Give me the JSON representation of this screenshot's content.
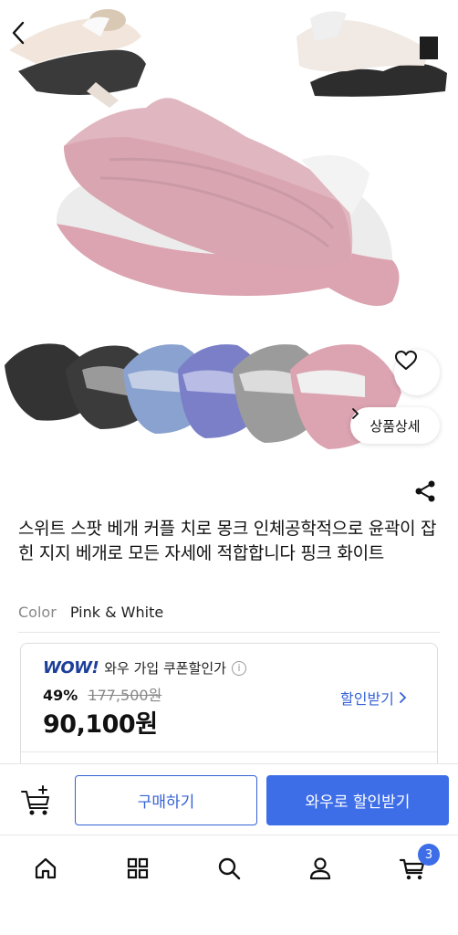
{
  "product": {
    "title": "스위트 스팟 베개 커플 치로 몽크 인체공학적으로 윤곽이 잡힌 지지 베개로 모든 자세에 적합합니다 핑크 화이트",
    "color_label": "Color",
    "color_value": "Pink & White",
    "detail_button": "상품상세",
    "image_alt": "pillow-product-image"
  },
  "price": {
    "wow_logo": "WOW!",
    "wow_caption": "와우 가입 쿠폰할인가",
    "discount_pct": "49%",
    "original_price": "177,500원",
    "final_price": "90,100원",
    "coupon_link": "할인받기"
  },
  "actions": {
    "buy_label": "구매하기",
    "wow_label": "와우로 할인받기"
  },
  "tabs": {
    "cart_count": "3",
    "items": [
      "home-icon",
      "grid-icon",
      "search-icon",
      "user-icon",
      "cart-icon"
    ]
  },
  "colors": {
    "accent": "#3d6ee8",
    "link": "#3462d6",
    "wow_brand": "#1c3f99",
    "pillow_pink": "#dca3b1",
    "pillow_white": "#ececec"
  }
}
